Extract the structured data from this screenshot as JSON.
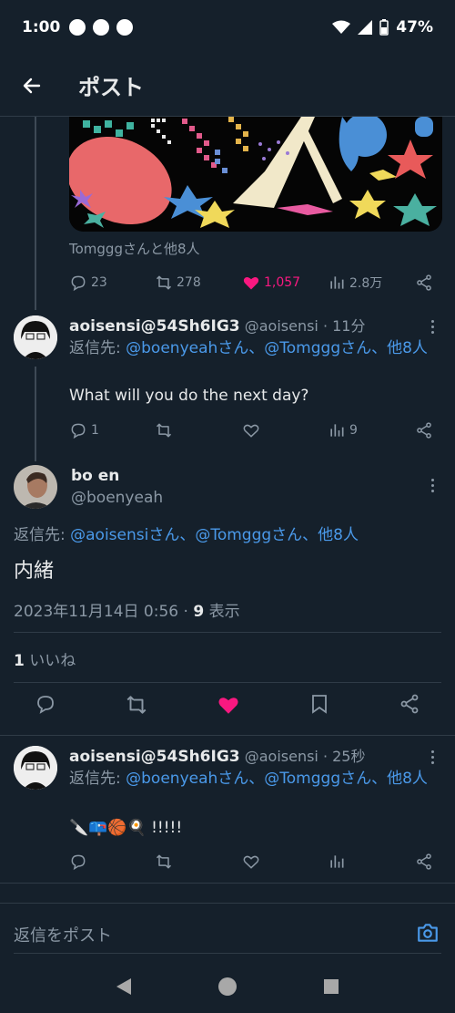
{
  "status": {
    "time": "1:00",
    "battery": "47%"
  },
  "header": {
    "title": "ポスト"
  },
  "parent": {
    "context": "Tomgggさんと他8人",
    "replies": "23",
    "reposts": "278",
    "likes": "1,057",
    "views": "2.8万"
  },
  "reply1": {
    "name": "aoisensi@54Sh6IG3",
    "handle": "@aoisensi",
    "time": "· 11分",
    "reply_to_prefix": "返信先: ",
    "reply_to_users": "@boenyeahさん、@Tomgggさん、他8人",
    "text": "What will you do the next day?",
    "replies": "1",
    "views": "9"
  },
  "main": {
    "name": "bo en",
    "handle": "@boenyeah",
    "reply_to_prefix": "返信先: ",
    "reply_to_users": "@aoisensiさん、@Tomgggさん、他8人",
    "text": "内緒",
    "timestamp": "2023年11月14日 0:56 · ",
    "views_count": "9",
    "views_label": " 表示",
    "likes_count": "1",
    "likes_label": " いいね"
  },
  "reply2": {
    "name": "aoisensi@54Sh6IG3",
    "handle": "@aoisensi",
    "time": "· 25秒",
    "reply_to_prefix": "返信先: ",
    "reply_to_users": "@boenyeahさん、@Tomgggさん、他8人",
    "text": "🔪📪🏀🍳 !!!!!"
  },
  "composer": {
    "placeholder": "返信をポスト"
  },
  "colors": {
    "background": "#15202b",
    "accent": "#4a99e9",
    "like": "#f91880"
  }
}
